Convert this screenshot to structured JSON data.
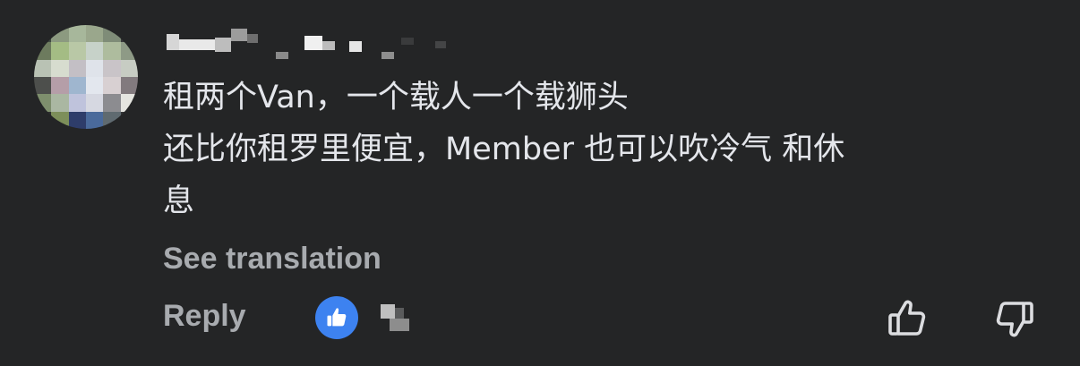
{
  "comment": {
    "text_line1": "租两个Van，一个载人一个载狮头",
    "text_line2": "还比你租罗里便宜，Member 也可以吹冷气 和休",
    "text_line3": "息",
    "see_translation_label": "See translation",
    "reply_label": "Reply",
    "reaction_icon": "thumbs-up-icon",
    "upvote_icon": "upvote-icon",
    "downvote_icon": "downvote-icon"
  },
  "colors": {
    "background": "#242526",
    "text": "#e4e6eb",
    "secondary_text": "#a8abaf",
    "like_blue": "#3d82f0"
  }
}
